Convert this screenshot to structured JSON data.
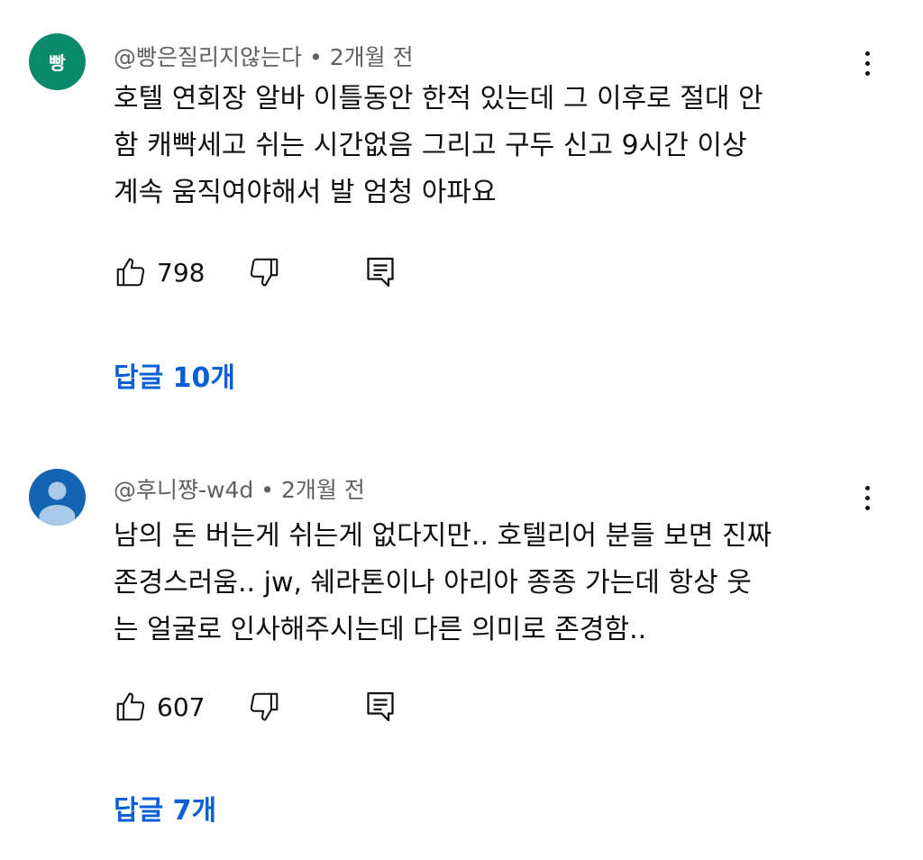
{
  "comments": [
    {
      "avatar_letter": "빵",
      "author": "@빵은질리지않는다",
      "separator": "•",
      "time": "2개월 전",
      "lines": [
        "호텔 연회장 알바 이틀동안 한적 있는데 그 이후로 절대 안",
        "함 캐빡세고 쉬는 시간없음 그리고 구두 신고 9시간 이상",
        "계속 움직여야해서 발 엄청 아파요"
      ],
      "likes": "798",
      "replies_label": "답글 10개",
      "avatar_color": "#0a8a6a"
    },
    {
      "avatar_letter": "",
      "author": "@후니쨩-w4d",
      "separator": "•",
      "time": "2개월 전",
      "lines": [
        "남의 돈 버는게 쉬는게 없다지만.. 호텔리어 분들 보면 진짜",
        "존경스러움.. jw, 쉐라톤이나 아리아 종종 가는데 항상 웃",
        "는 얼굴로 인사해주시는데 다른 의미로 존경함.."
      ],
      "likes": "607",
      "replies_label": "답글 7개",
      "avatar_color": "#1464b4"
    }
  ],
  "icons": {
    "like": "thumb-up-icon",
    "dislike": "thumb-down-icon",
    "reply": "reply-comment-icon",
    "more": "more-vertical-icon",
    "default_avatar": "default-user-avatar-icon"
  },
  "colors": {
    "link": "#065fd4",
    "meta": "#606060",
    "text": "#0f0f0f"
  }
}
